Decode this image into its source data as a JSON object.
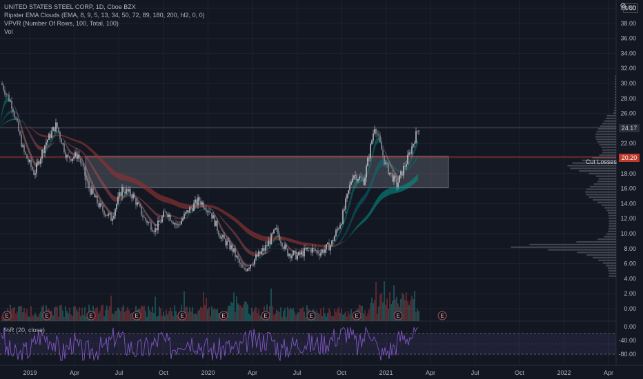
{
  "chart_data": {
    "type": "candlestick",
    "title": "UNITED STATES STEEL CORP, 1D, Cboe BZX",
    "currency": "USD",
    "indicators": [
      "Ripster EMA Clouds (EMA, 8, 9, 5, 13, 34, 50, 72, 89, 180, 200, hl2, 0, 0)",
      "VPVR (Number Of Rows, 100, Total, 100)",
      "Vol"
    ],
    "price_axis": {
      "ticks": [
        "0.00",
        "2.00",
        "4.00",
        "6.00",
        "8.00",
        "10.00",
        "12.00",
        "14.00",
        "16.00",
        "18.00",
        "20.00",
        "22.00",
        "24.00",
        "26.00",
        "28.00",
        "30.00",
        "32.00",
        "34.00",
        "36.00",
        "38.00",
        "40.00"
      ],
      "range": [
        0,
        40
      ]
    },
    "time_axis": {
      "ticks": [
        "2019",
        "Apr",
        "Jul",
        "Oct",
        "2020",
        "Apr",
        "Jul",
        "Oct",
        "2021",
        "Apr",
        "Jul",
        "Oct",
        "2022",
        "Apr"
      ]
    },
    "last_price": "24.17",
    "level_label": "Cut Losses",
    "level_price": "20.20",
    "zone": {
      "from": 16.1,
      "to": 20.3
    },
    "earnings_marker": "E",
    "price_path": [
      {
        "t": "2018-12",
        "p": 30
      },
      {
        "t": "2018-12",
        "p": 27
      },
      {
        "t": "2019-01",
        "p": 21
      },
      {
        "t": "2019-01",
        "p": 18
      },
      {
        "t": "2019-02",
        "p": 22
      },
      {
        "t": "2019-03",
        "p": 24.5
      },
      {
        "t": "2019-04",
        "p": 20
      },
      {
        "t": "2019-04",
        "p": 20.5
      },
      {
        "t": "2019-05",
        "p": 16
      },
      {
        "t": "2019-06",
        "p": 13.5
      },
      {
        "t": "2019-06",
        "p": 12
      },
      {
        "t": "2019-07",
        "p": 16
      },
      {
        "t": "2019-07",
        "p": 15
      },
      {
        "t": "2019-08",
        "p": 12
      },
      {
        "t": "2019-08",
        "p": 10.5
      },
      {
        "t": "2019-09",
        "p": 13
      },
      {
        "t": "2019-10",
        "p": 11
      },
      {
        "t": "2019-11",
        "p": 13
      },
      {
        "t": "2019-12",
        "p": 14.5
      },
      {
        "t": "2020-01",
        "p": 13
      },
      {
        "t": "2020-02",
        "p": 9.5
      },
      {
        "t": "2020-03",
        "p": 8
      },
      {
        "t": "2020-03",
        "p": 5
      },
      {
        "t": "2020-04",
        "p": 6.5
      },
      {
        "t": "2020-05",
        "p": 8
      },
      {
        "t": "2020-06",
        "p": 10.5
      },
      {
        "t": "2020-06",
        "p": 7.5
      },
      {
        "t": "2020-07",
        "p": 7
      },
      {
        "t": "2020-08",
        "p": 8
      },
      {
        "t": "2020-09",
        "p": 7.5
      },
      {
        "t": "2020-10",
        "p": 8.5
      },
      {
        "t": "2020-11",
        "p": 12
      },
      {
        "t": "2020-12",
        "p": 18
      },
      {
        "t": "2021-01",
        "p": 17
      },
      {
        "t": "2021-01",
        "p": 24.5
      },
      {
        "t": "2021-02",
        "p": 19
      },
      {
        "t": "2021-02",
        "p": 16.5
      },
      {
        "t": "2021-02",
        "p": 20
      },
      {
        "t": "2021-03",
        "p": 24.2
      }
    ],
    "wr_indicator": {
      "title": "%R (20, close)",
      "ticks": [
        "0.00",
        "-40.00",
        "-80.00"
      ],
      "levels": [
        -20,
        -80
      ]
    }
  }
}
